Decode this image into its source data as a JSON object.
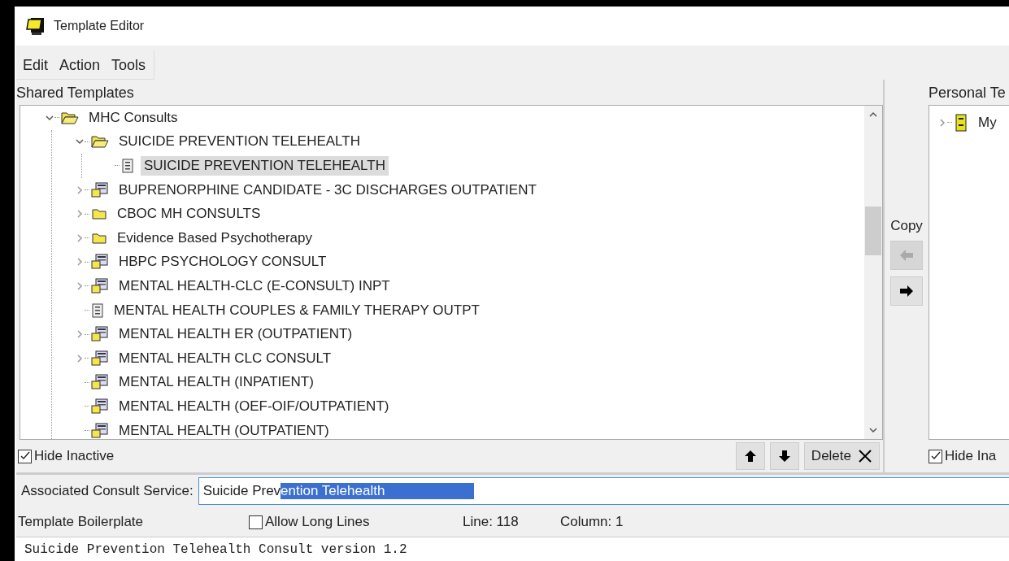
{
  "window": {
    "title": "Template Editor"
  },
  "menu": [
    {
      "label": "Edit"
    },
    {
      "label": "Action"
    },
    {
      "label": "Tools"
    }
  ],
  "shared_templates": {
    "label": "Shared Templates",
    "tree": [
      {
        "label": "MHC Consults",
        "kind": "folder-open",
        "expanded": true,
        "selected": false,
        "children": [
          {
            "label": "SUICIDE PREVENTION TELEHEALTH",
            "kind": "folder-open",
            "expanded": true,
            "selected": false,
            "children": [
              {
                "label": "SUICIDE PREVENTION TELEHEALTH",
                "kind": "document",
                "selected": true
              }
            ]
          },
          {
            "label": "BUPRENORPHINE CANDIDATE - 3C DISCHARGES OUTPATIENT",
            "kind": "group",
            "expanded": false,
            "selected": false
          },
          {
            "label": "CBOC MH CONSULTS",
            "kind": "folder",
            "expanded": false,
            "selected": false
          },
          {
            "label": "Evidence Based  Psychotherapy",
            "kind": "folder",
            "expanded": false,
            "selected": false
          },
          {
            "label": "HBPC PSYCHOLOGY CONSULT",
            "kind": "group",
            "expanded": false,
            "selected": false
          },
          {
            "label": "MENTAL HEALTH-CLC (E-CONSULT) INPT",
            "kind": "group",
            "expanded": false,
            "selected": false
          },
          {
            "label": "MENTAL HEALTH COUPLES & FAMILY THERAPY OUTPT",
            "kind": "document",
            "selected": false
          },
          {
            "label": "MENTAL HEALTH ER (OUTPATIENT)",
            "kind": "group",
            "expanded": false,
            "selected": false
          },
          {
            "label": "MENTAL HEALTH CLC CONSULT",
            "kind": "group",
            "expanded": false,
            "selected": false
          },
          {
            "label": "MENTAL HEALTH (INPATIENT)",
            "kind": "group",
            "selected": false
          },
          {
            "label": "MENTAL HEALTH (OEF-OIF/OUTPATIENT)",
            "kind": "group",
            "selected": false
          },
          {
            "label": "MENTAL HEALTH (OUTPATIENT)",
            "kind": "group",
            "selected": false
          }
        ]
      }
    ],
    "hide_inactive": {
      "label": "Hide Inactive",
      "checked": true
    },
    "delete_label": "Delete"
  },
  "copy": {
    "label": "Copy",
    "buttons": [
      {
        "kind": "left",
        "disabled": true
      },
      {
        "kind": "right",
        "disabled": false
      }
    ]
  },
  "personal_templates": {
    "label": "Personal Te",
    "tree": [
      {
        "label": "My",
        "kind": "cabinet",
        "expanded": false
      }
    ],
    "hide_inactive": {
      "label": "Hide Ina",
      "checked": true
    }
  },
  "associated_consult_service": {
    "label": "Associated Consult Service:",
    "value": "Suicide Prev",
    "selected_text": "ention Telehealth"
  },
  "boilerplate": {
    "label": "Template Boilerplate",
    "allow_long_lines": {
      "label": "Allow Long Lines",
      "checked": false
    },
    "line": "Line: 118",
    "column": "Column: 1",
    "text": "Suicide Prevention Telehealth Consult version 1.2"
  }
}
